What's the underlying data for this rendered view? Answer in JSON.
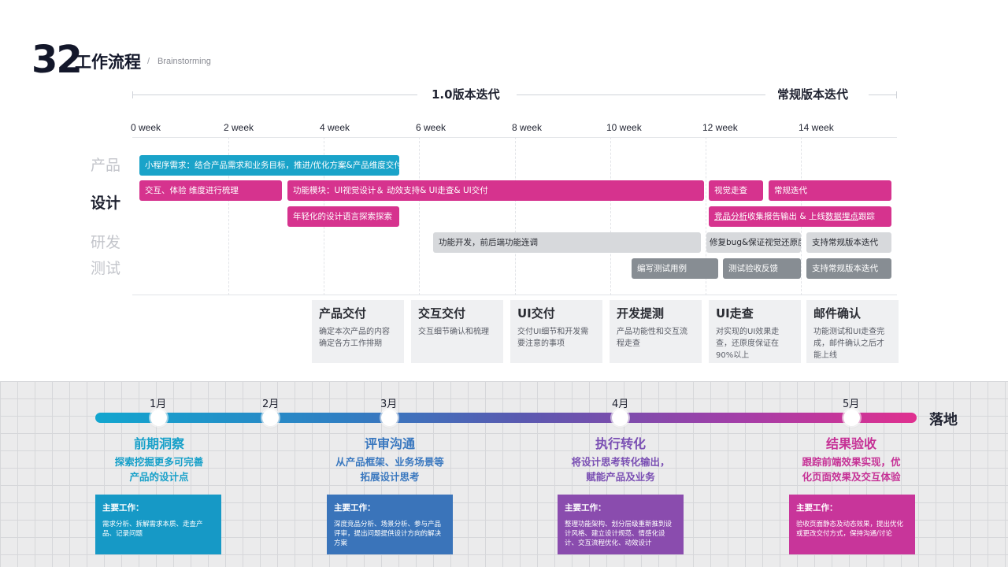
{
  "header": {
    "number": "32",
    "title": "工作流程",
    "slash": "/",
    "subtitle": "Brainstorming"
  },
  "phases": [
    "1.0版本迭代",
    "常规版本迭代"
  ],
  "weeks": [
    "0 week",
    "2 week",
    "4 week",
    "6 week",
    "8 week",
    "10 week",
    "12 week",
    "14 week"
  ],
  "rows": [
    "产品",
    "设计",
    "研发",
    "测试"
  ],
  "bars": {
    "b1": "小程序需求：结合产品需求和业务目标，推进/优化方案&产品维度交付",
    "b2": "交互、体验 维度进行梳理",
    "b3": "功能模块：UI视觉设计＆ 动效支持& UI走查& UI交付",
    "b4": "视觉走查",
    "b5": "常规迭代",
    "b6": "年轻化的设计语言探索探索",
    "b7a": "竞品分析",
    "b7b": "收集报告输出 & 上线",
    "b7c": "数据埋点",
    "b7d": "跟踪",
    "b8": "功能开发，前后端功能连调",
    "b9": "修复bug&保证视觉还原度",
    "b10": "支持常规版本迭代",
    "b11": "编写测试用例",
    "b12": "测试验收反馈",
    "b13": "支持常规版本迭代"
  },
  "cards": [
    {
      "title": "产品交付",
      "desc": "确定本次产品的内容确定各方工作排期"
    },
    {
      "title": "交互交付",
      "desc": "交互细节确认和梳理"
    },
    {
      "title": "UI交付",
      "desc": "交付UI细节和开发需要注意的事项"
    },
    {
      "title": "开发提测",
      "desc": "产品功能性和交互流程走查"
    },
    {
      "title": "UI走查",
      "desc": "对实现的UI效果走查，还原度保证在90%以上"
    },
    {
      "title": "邮件确认",
      "desc": "功能测试和UI走查完成，邮件确认之后才能上线"
    }
  ],
  "months": [
    "1月",
    "2月",
    "3月",
    "4月",
    "5月"
  ],
  "landing": "落地",
  "stages": [
    {
      "title": "前期洞察",
      "desc1": "探索挖掘更多可完善",
      "desc2": "产品的设计点",
      "color": "#17a0c9"
    },
    {
      "title": "评审沟通",
      "desc1": "从产品框架、业务场景等",
      "desc2": "拓展设计思考",
      "color": "#3a78bf"
    },
    {
      "title": "执行转化",
      "desc1": "将设计思考转化输出，",
      "desc2": "赋能产品及业务",
      "color": "#7a4fb3"
    },
    {
      "title": "结果验收",
      "desc1": "跟踪前端效果实现，优",
      "desc2": "化页面效果及交互体验",
      "color": "#c63196"
    }
  ],
  "works": [
    {
      "title": "主要工作：",
      "desc": "需求分析、拆解需求本质、走查产品、记录问题",
      "color": "#1699c6"
    },
    {
      "title": "主要工作：",
      "desc": "深度竞品分析、场景分析、参与产品评审，提出问题提供设计方向的解决方案",
      "color": "#3a74ba"
    },
    {
      "title": "主要工作：",
      "desc": "整理功能架构、划分层级重新推到设计风格、建立设计规范、情感化设计、交互流程优化、动效设计",
      "color": "#8a4cae"
    },
    {
      "title": "主要工作：",
      "desc": "验收页面静态及动态效果，提出优化或更改交付方式，保持沟通/讨论",
      "color": "#c8359a"
    }
  ]
}
